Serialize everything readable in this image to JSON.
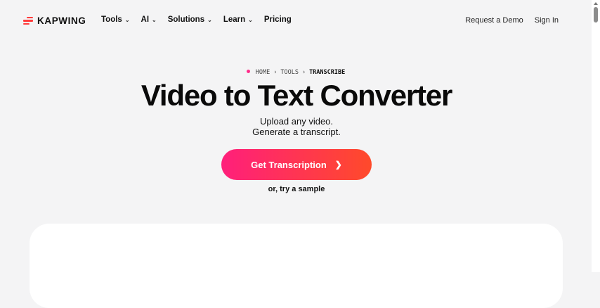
{
  "nav": {
    "logo_text": "KAPWING",
    "menu": [
      {
        "label": "Tools",
        "has_dropdown": true
      },
      {
        "label": "AI",
        "has_dropdown": true
      },
      {
        "label": "Solutions",
        "has_dropdown": true
      },
      {
        "label": "Learn",
        "has_dropdown": true
      },
      {
        "label": "Pricing",
        "has_dropdown": false
      }
    ],
    "request_demo": "Request a Demo",
    "sign_in": "Sign In"
  },
  "breadcrumb": {
    "home": "HOME",
    "tools": "TOOLS",
    "current": "TRANSCRIBE"
  },
  "hero": {
    "title": "Video to Text Converter",
    "subtitle_line1": "Upload any video.",
    "subtitle_line2": "Generate a transcript.",
    "cta_label": "Get Transcription",
    "sample_link": "or, try a sample"
  },
  "colors": {
    "brand_red": "#ff3b3b",
    "cta_gradient_start": "#ff1f7b",
    "cta_gradient_end": "#ff4a2a",
    "breadcrumb_dot": "#ff2d8a"
  }
}
